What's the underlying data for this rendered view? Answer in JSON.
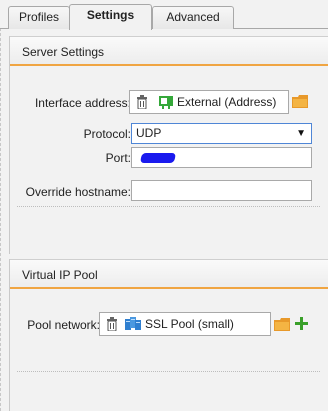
{
  "tabs": [
    {
      "label": "Profiles",
      "active": false
    },
    {
      "label": "Settings",
      "active": true
    },
    {
      "label": "Advanced",
      "active": false
    }
  ],
  "server_settings": {
    "title": "Server Settings",
    "interface_label": "Interface address:",
    "interface_value": "External (Address)",
    "protocol_label": "Protocol:",
    "protocol_value": "UDP",
    "port_label": "Port:",
    "port_value_redacted": true,
    "override_label": "Override hostname:",
    "override_value": ""
  },
  "virtual_ip_pool": {
    "title": "Virtual IP Pool",
    "pool_label": "Pool network:",
    "pool_value": "SSL Pool (small)"
  },
  "colors": {
    "accent": "#f0a542",
    "folder": "#e8992a",
    "add": "#3aa02a",
    "network_green": "#35a83a",
    "pool_blue": "#2f7fd0",
    "redaction": "#1a1aee"
  },
  "icons": [
    "trash-icon",
    "network-icon",
    "folder-icon",
    "pool-icon",
    "plus-icon",
    "chevron-down-icon"
  ]
}
